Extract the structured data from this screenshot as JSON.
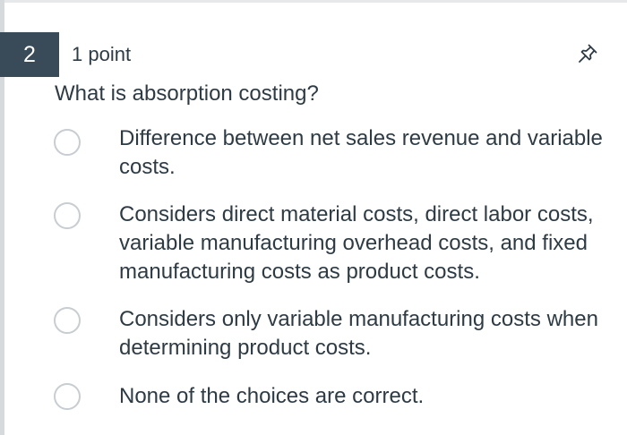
{
  "question": {
    "number": "2",
    "points": "1 point",
    "text": "What is absorption costing?",
    "pin_icon": "pin-icon"
  },
  "options": [
    {
      "text": "Difference between net sales revenue and variable costs."
    },
    {
      "text": "Considers direct material costs, direct labor costs, variable manufacturing overhead costs, and fixed manufacturing costs as product costs."
    },
    {
      "text": "Considers only variable manufacturing costs when determining product costs."
    },
    {
      "text": "None of the choices are correct."
    }
  ],
  "colors": {
    "number_badge": "#394b58",
    "text": "#2d3b45",
    "radio_border": "#c7cdd1"
  }
}
